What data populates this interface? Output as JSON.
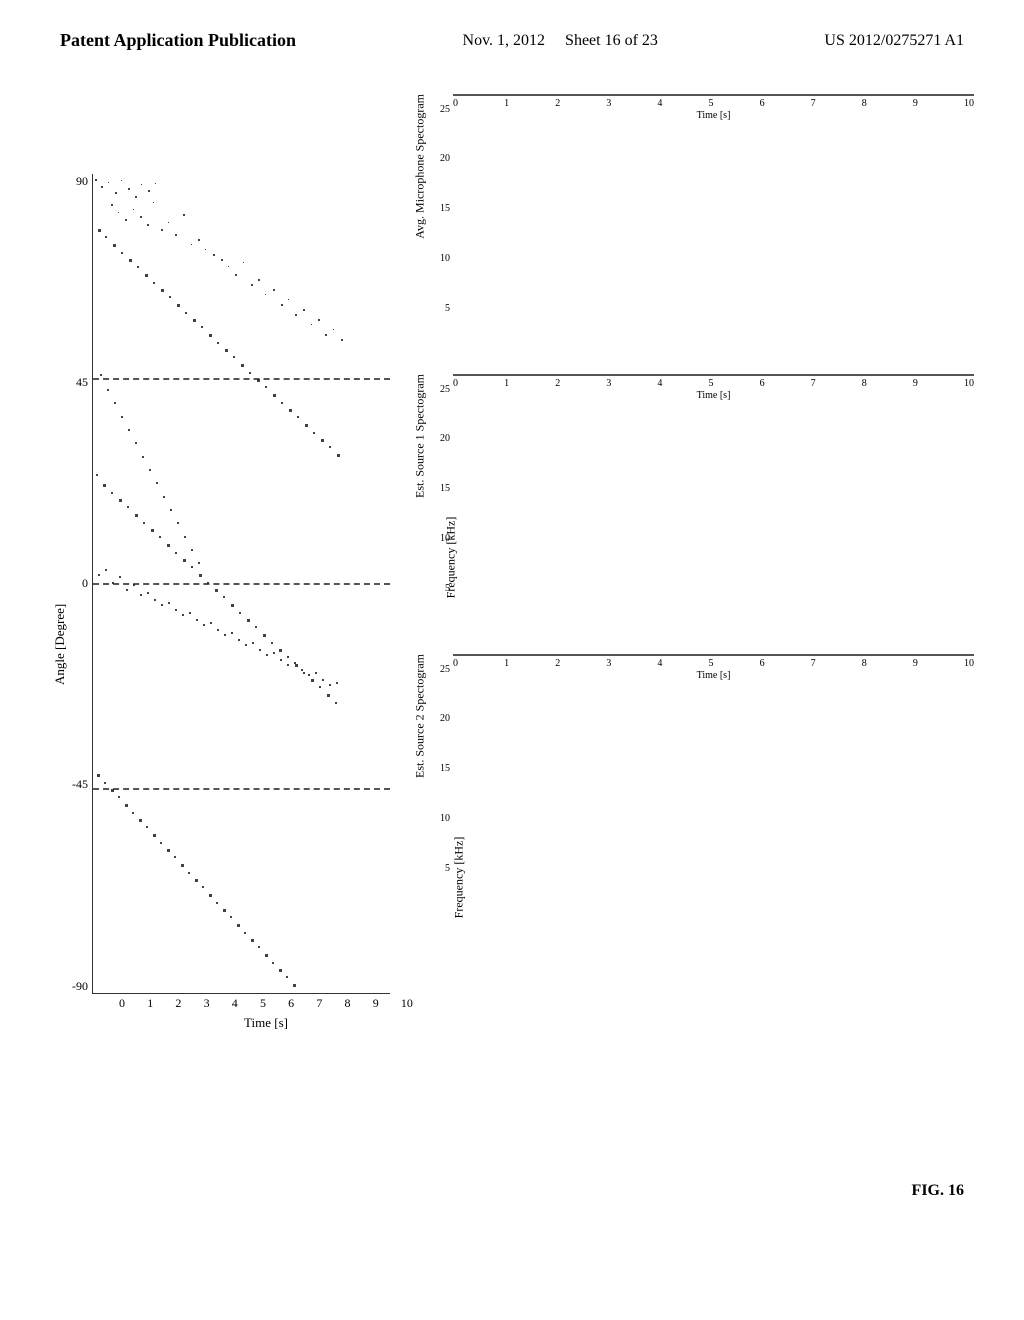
{
  "header": {
    "left_label": "Patent Application Publication",
    "center_date": "Nov. 1, 2012",
    "center_sheet": "Sheet 16 of 23",
    "right_patent": "US 2012/0275271 A1"
  },
  "fig_label": "FIG. 16",
  "left_plot": {
    "y_axis_label": "Angle [Degree]",
    "y_ticks": [
      "90",
      "45",
      "0",
      "-45",
      "-90"
    ],
    "x_ticks": [
      "0",
      "1",
      "2",
      "3",
      "4",
      "5",
      "6",
      "7",
      "8",
      "9",
      "10"
    ],
    "x_axis_label": "Time [s]"
  },
  "spectrograms": [
    {
      "title": "Avg. Microphone Spectogram",
      "y_label": "Frequency [kHz]",
      "y_ticks": [
        "25",
        "20",
        "15",
        "10",
        "5"
      ],
      "x_ticks": [
        "0",
        "1",
        "2",
        "3",
        "4",
        "5",
        "6",
        "7",
        "8",
        "9",
        "10"
      ],
      "x_label": "Time [s]"
    },
    {
      "title": "Est. Source 1 Spectogram",
      "y_label": "",
      "y_ticks": [
        "25",
        "20",
        "15",
        "10",
        "5"
      ],
      "x_ticks": [
        "0",
        "1",
        "2",
        "3",
        "4",
        "5",
        "6",
        "7",
        "8",
        "9",
        "10"
      ],
      "x_label": "Time [s]"
    },
    {
      "title": "Est. Source 2 Spectogram",
      "y_label": "",
      "y_ticks": [
        "25",
        "20",
        "15",
        "10",
        "5"
      ],
      "x_ticks": [
        "0",
        "1",
        "2",
        "3",
        "4",
        "5",
        "6",
        "7",
        "8",
        "9",
        "10"
      ],
      "x_label": "Time [s]"
    }
  ]
}
